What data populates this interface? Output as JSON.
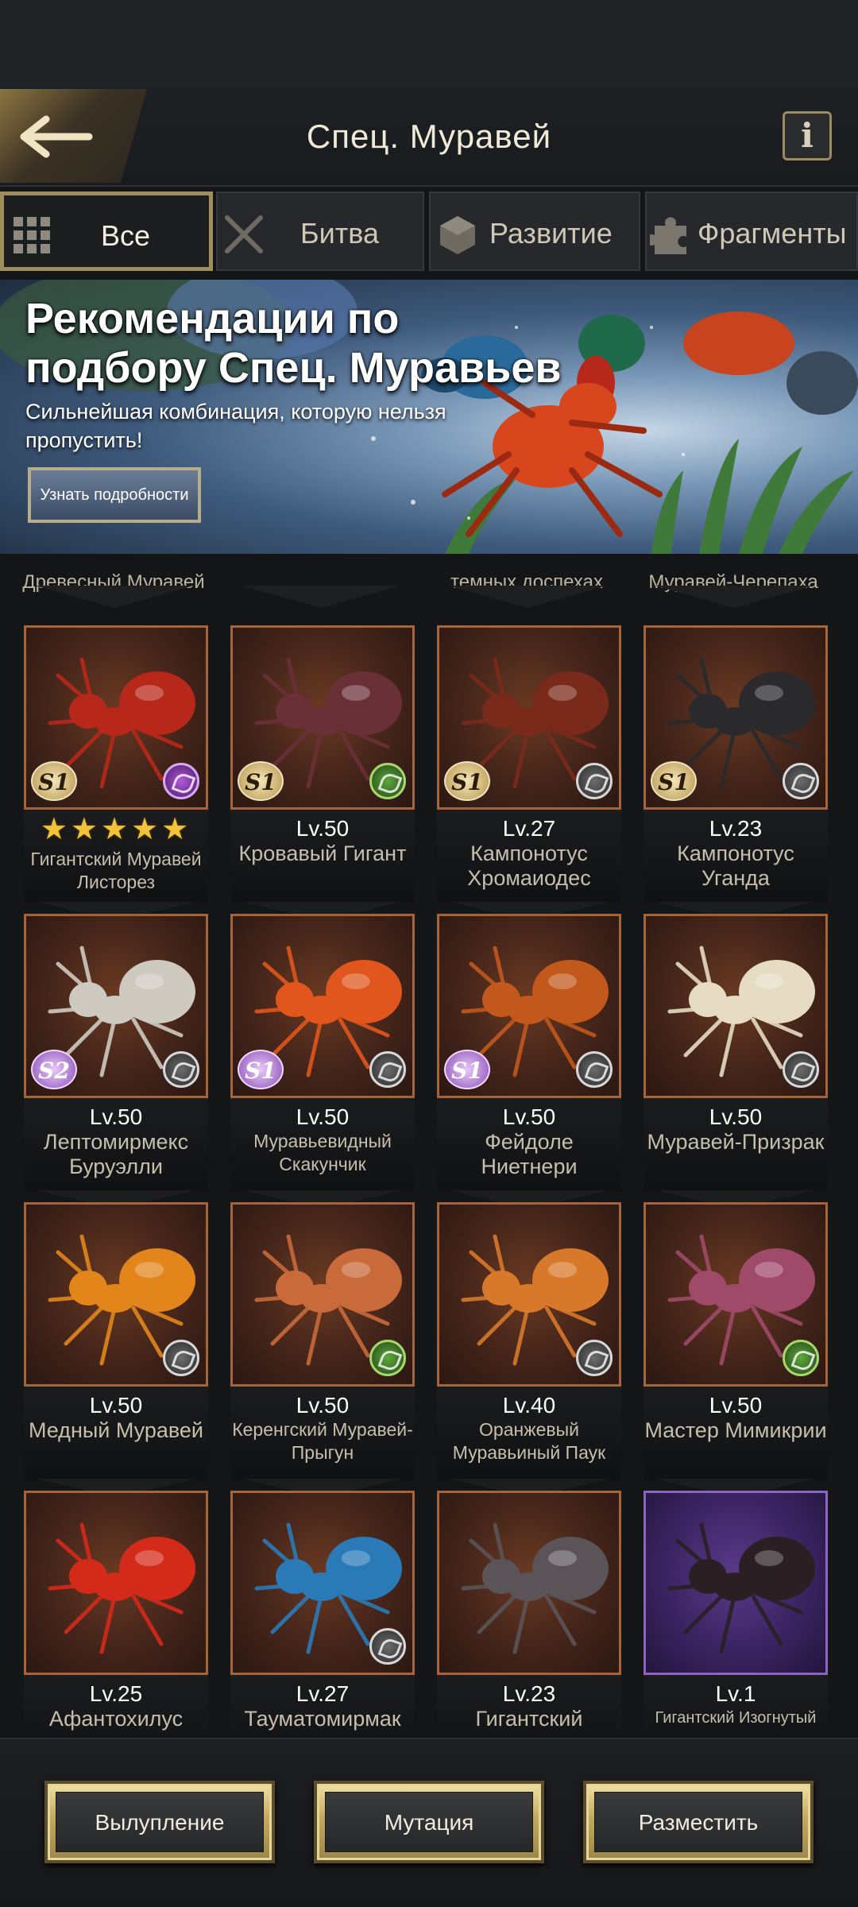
{
  "header": {
    "title": "Спец. Муравей",
    "info_label": "i"
  },
  "tabs": [
    {
      "label": "Все",
      "icon": "grid-icon",
      "active": true
    },
    {
      "label": "Битва",
      "icon": "crossed-swords-icon",
      "active": false
    },
    {
      "label": "Развитие",
      "icon": "cube-icon",
      "active": false
    },
    {
      "label": "Фрагменты",
      "icon": "puzzle-icon",
      "active": false
    }
  ],
  "banner": {
    "title_line1": "Рекомендации по",
    "title_line2": "подбору Спец. Муравьев",
    "subtitle": "Сильнейшая комбинация, которую нельзя пропустить!",
    "button_label": "Узнать подробности"
  },
  "partial_row": [
    "Древесный Муравей",
    "",
    "темных доспехах",
    "Муравей-Черепаха"
  ],
  "cards": [
    {
      "stars": "★★★★★",
      "level": "",
      "name": "Гигантский Муравей Листорез",
      "rank": "S1",
      "type_icon": "leaf-icon",
      "type_color": "#b05ad8",
      "body_color": "#b8281a"
    },
    {
      "stars": "",
      "level": "Lv.50",
      "name": "Кровавый Гигант",
      "rank": "S1",
      "type_icon": "leaf-icon",
      "type_color": "#5ea83a",
      "body_color": "#6a3038"
    },
    {
      "stars": "",
      "level": "Lv.27",
      "name": "Кампонотус Хромаиодес",
      "rank": "S1",
      "type_icon": "claw-icon",
      "type_color": "#6c6c6c",
      "body_color": "#7a2a1a"
    },
    {
      "stars": "",
      "level": "Lv.23",
      "name": "Кампонотус Уганда",
      "rank": "S1",
      "type_icon": "claw-icon",
      "type_color": "#6c6c6c",
      "body_color": "#2a2a2c"
    },
    {
      "stars": "",
      "level": "Lv.50",
      "name": "Лептомирмекс Буруэлли",
      "rank": "S2",
      "type_icon": "shell-icon",
      "type_color": "#6c6c6c",
      "body_color": "#cfcac0"
    },
    {
      "stars": "",
      "level": "Lv.50",
      "name": "Муравьевидный Скакунчик",
      "rank": "S1",
      "type_icon": "claw-icon",
      "type_color": "#6c6c6c",
      "body_color": "#e0561c"
    },
    {
      "stars": "",
      "level": "Lv.50",
      "name": "Фейдоле Ниетнери",
      "rank": "S1",
      "type_icon": "claw-icon",
      "type_color": "#6c6c6c",
      "body_color": "#c2581c"
    },
    {
      "stars": "",
      "level": "Lv.50",
      "name": "Муравей-Призрак",
      "rank": "",
      "type_icon": "shell-icon",
      "type_color": "#6c6c6c",
      "body_color": "#e6dcc4"
    },
    {
      "stars": "",
      "level": "Lv.50",
      "name": "Медный Муравей",
      "rank": "",
      "type_icon": "claw-icon",
      "type_color": "#6c6c6c",
      "body_color": "#e2861c"
    },
    {
      "stars": "",
      "level": "Lv.50",
      "name": "Керенгский Муравей-Прыгун",
      "rank": "",
      "type_icon": "leaf-icon",
      "type_color": "#5ea83a",
      "body_color": "#c86a3a"
    },
    {
      "stars": "",
      "level": "Lv.40",
      "name": "Оранжевый Муравьиный Паук",
      "rank": "",
      "type_icon": "claw-icon",
      "type_color": "#6c6c6c",
      "body_color": "#d8782a"
    },
    {
      "stars": "",
      "level": "Lv.50",
      "name": "Мастер Мимикрии",
      "rank": "",
      "type_icon": "leaf-icon",
      "type_color": "#5ea83a",
      "body_color": "#a04a6a"
    },
    {
      "stars": "",
      "level": "Lv.25",
      "name": "Афантохилус",
      "rank": "",
      "type_icon": "",
      "type_color": "",
      "body_color": "#d42a1a"
    },
    {
      "stars": "",
      "level": "Lv.27",
      "name": "Тауматомирмак",
      "rank": "",
      "type_icon": "claw-icon",
      "type_color": "#6c6c6c",
      "body_color": "#2a7ab8"
    },
    {
      "stars": "",
      "level": "Lv.23",
      "name": "Гигантский",
      "rank": "",
      "type_icon": "",
      "type_color": "",
      "body_color": "#5a5458"
    },
    {
      "stars": "",
      "level": "Lv.1",
      "name": "Гигантский Изогнутый",
      "rank": "",
      "type_icon": "",
      "type_color": "",
      "body_color": "#2a2024",
      "frame": "purple"
    }
  ],
  "footer": {
    "hatch_label": "Вылупление",
    "mutation_label": "Мутация",
    "deploy_label": "Разместить"
  }
}
